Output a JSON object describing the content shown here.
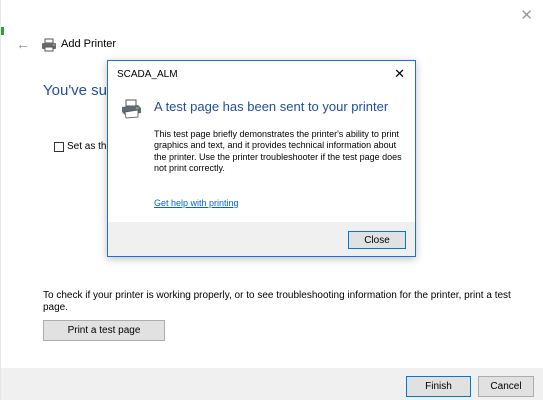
{
  "wizard": {
    "title": "Add Printer",
    "heading": "You've suc",
    "set_default_label": "Set as th",
    "check_info": "To check if your printer is working properly, or to see troubleshooting information for the printer, print a test page.",
    "print_test_label": "Print a test page",
    "finish_label": "Finish",
    "cancel_label": "Cancel",
    "close_glyph": "✕",
    "back_glyph": "←"
  },
  "dialog": {
    "title": "SCADA_ALM",
    "close_glyph": "✕",
    "heading": "A test page has been sent to your printer",
    "body": "This test page briefly demonstrates the printer's ability to print graphics and text, and it provides technical information about the printer. Use the printer troubleshooter if the test page does not print correctly.",
    "help_link": "Get help with printing",
    "close_label": "Close"
  },
  "colors": {
    "accent_blue": "#1f4e9c",
    "link_blue": "#0066cc",
    "focus_border": "#0078d7",
    "footer_gray": "#f0f0f0"
  },
  "icons": {
    "back": "back-arrow-icon",
    "printer": "printer-icon",
    "close": "close-icon"
  }
}
